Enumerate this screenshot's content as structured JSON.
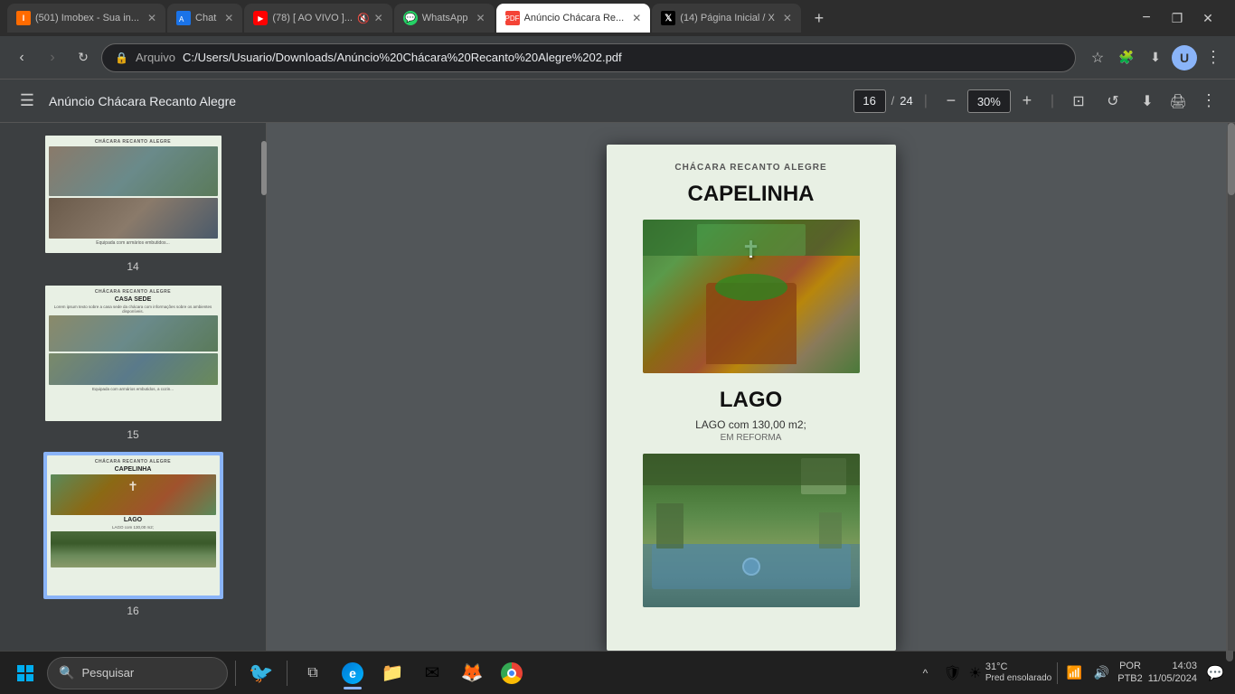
{
  "browser": {
    "tabs": [
      {
        "id": "imobex",
        "label": "(501) Imobex - Sua in...",
        "favicon": "imobex",
        "active": false,
        "closeable": true
      },
      {
        "id": "chat",
        "label": "Chat",
        "favicon": "chat",
        "active": false,
        "closeable": true
      },
      {
        "id": "youtube",
        "label": "(78) [ AO VIVO ]...",
        "favicon": "yt",
        "active": false,
        "closeable": true,
        "muted": true
      },
      {
        "id": "whatsapp",
        "label": "WhatsApp",
        "favicon": "wa",
        "active": false,
        "closeable": true
      },
      {
        "id": "pdf",
        "label": "Anúncio Chácara Re...",
        "favicon": "pdf",
        "active": true,
        "closeable": true
      },
      {
        "id": "twitter",
        "label": "(14) Página Inicial / X",
        "favicon": "x",
        "active": false,
        "closeable": true
      }
    ],
    "address": "C:/Users/Usuario/Downloads/Anúncio%20Chácara%20Recanto%20Alegre%202.pdf",
    "address_display": "Arquivo  C:/Users/Usuario/Downloads/Anúncio%20Chácara%20Recanto%20Alegre%202.pdf"
  },
  "pdf": {
    "toolbar": {
      "title": "Anúncio Chácara Recanto Alegre",
      "current_page": "16",
      "total_pages": "24",
      "zoom": "30%",
      "menu_icon": "☰",
      "download_icon": "⬇",
      "print_icon": "🖨",
      "more_icon": "⋮",
      "zoom_out_icon": "−",
      "zoom_in_icon": "+",
      "page_separator": "/",
      "fit_page_icon": "⊡",
      "rotate_icon": "↺"
    },
    "page": {
      "brand": "CHÁCARA RECANTO ALEGRE",
      "section1_title": "CAPELINHA",
      "section2_title": "LAGO",
      "lago_desc": "LAGO com 130,00 m2;",
      "lago_note": "EM REFORMA"
    },
    "thumbnails": [
      {
        "num": "14",
        "selected": false,
        "brand": "CHÁCARA RECANTO ALEGRE",
        "type": "interior",
        "has_image": true
      },
      {
        "num": "15",
        "selected": false,
        "brand": "CHÁCARA RECANTO ALEGRE",
        "title": "CASA SEDE",
        "type": "house",
        "has_image": true,
        "note": "Equipada com armários embutidos, a cozin..."
      },
      {
        "num": "16",
        "selected": true,
        "brand": "CHÁCARA RECANTO ALEGRE",
        "title": "CAPELINHA",
        "type": "chapel_lake",
        "has_image": true
      }
    ]
  },
  "taskbar": {
    "search_placeholder": "Pesquisar",
    "apps": [
      "windows",
      "search",
      "task-view",
      "edge",
      "explorer",
      "mail",
      "firefox",
      "chrome"
    ],
    "systray": {
      "temperature": "31°C",
      "weather": "Pred ensolarado",
      "language": "POR",
      "keyboard": "PTB2",
      "time": "14:03",
      "date": "11/05/2024"
    }
  }
}
